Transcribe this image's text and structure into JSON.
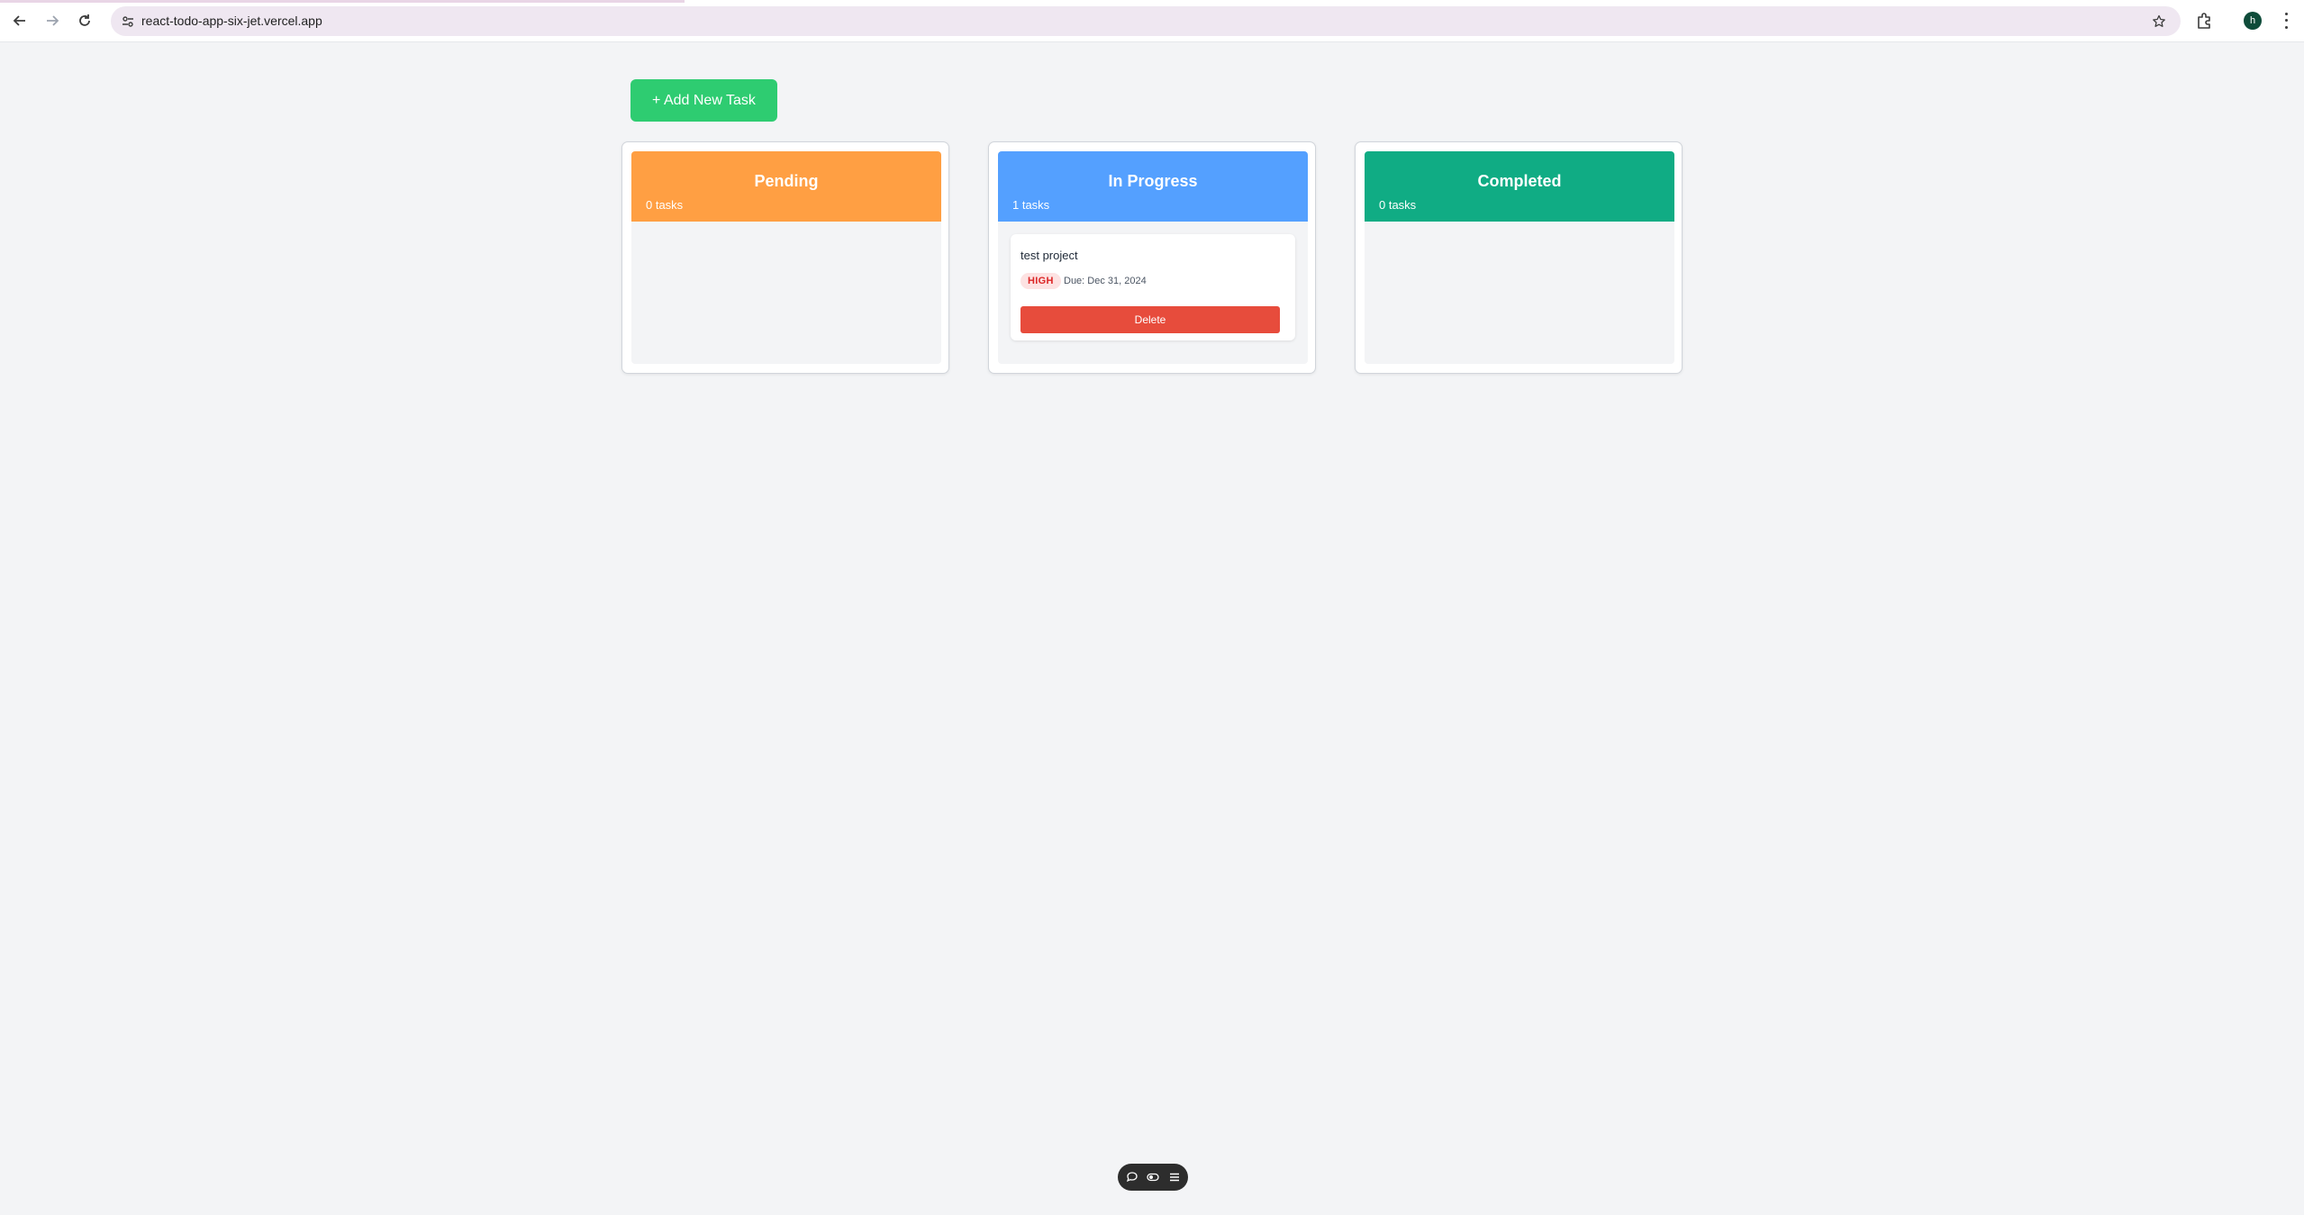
{
  "browser": {
    "url": "react-todo-app-six-jet.vercel.app",
    "profile_initial": "h"
  },
  "app": {
    "add_task_label": "+ Add New Task",
    "columns": [
      {
        "title": "Pending",
        "count_label": "0 tasks",
        "color": "#ff9f43"
      },
      {
        "title": "In Progress",
        "count_label": "1 tasks",
        "color": "#54a0ff"
      },
      {
        "title": "Completed",
        "count_label": "0 tasks",
        "color": "#10ac84"
      }
    ],
    "tasks": [
      {
        "title": "test project",
        "priority": "HIGH",
        "due": "Due: Dec 31, 2024",
        "delete_label": "Delete"
      }
    ]
  },
  "colors": {
    "add_button": "#2ecc71",
    "delete_button": "#e74c3c",
    "background": "#f3f4f6"
  },
  "icons": [
    "back-arrow-icon",
    "forward-arrow-icon",
    "reload-icon",
    "site-info-icon",
    "bookmark-star-icon",
    "extensions-icon",
    "kebab-menu-icon",
    "comment-icon",
    "toggle-icon",
    "list-icon"
  ]
}
